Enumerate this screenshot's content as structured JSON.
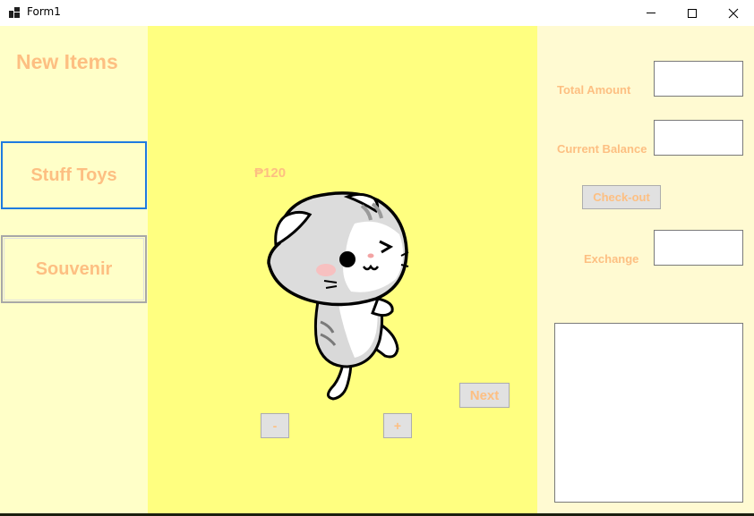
{
  "window": {
    "title": "Form1"
  },
  "left_panel": {
    "heading": "New Items",
    "categories": [
      {
        "label": "Stuff Toys",
        "selected": true
      },
      {
        "label": "Souvenir",
        "selected": false
      }
    ]
  },
  "product": {
    "price": "₱120",
    "image": "cartoon-gray-cat-icon",
    "decrease_label": "-",
    "increase_label": "+",
    "next_label": "Next"
  },
  "checkout": {
    "total_amount_label": "Total Amount",
    "total_amount_value": "",
    "current_balance_label": "Current Balance",
    "current_balance_value": "",
    "checkout_label": "Check-out",
    "exchange_label": "Exchange",
    "exchange_value": "",
    "receipt_items": []
  },
  "colors": {
    "left_panel_bg": "#ffffc8",
    "center_panel_bg": "#ffff80",
    "right_panel_bg": "#fffad2",
    "label_text": "#fdbf82",
    "selected_border": "#1e7be0"
  }
}
